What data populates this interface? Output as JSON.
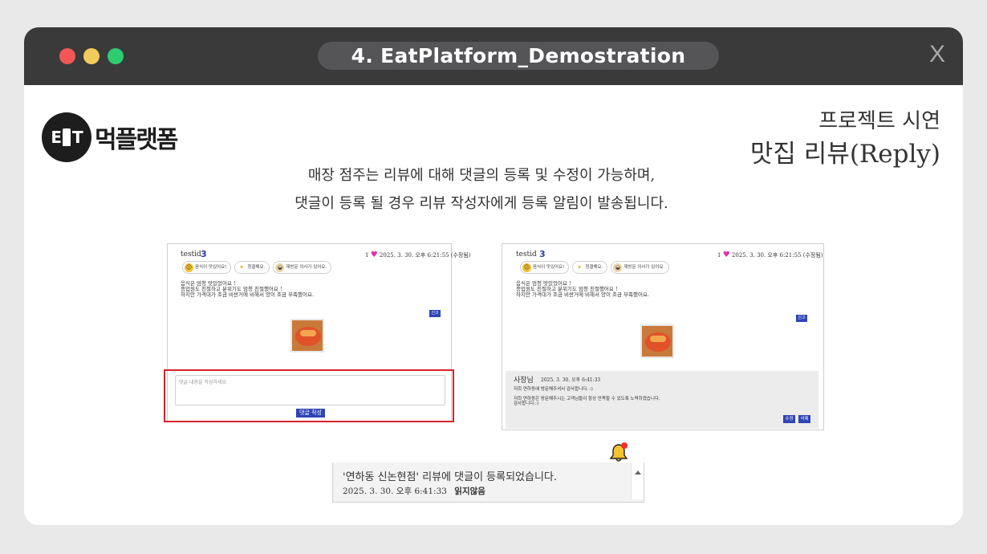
{
  "window": {
    "title": "4. EatPlatform_Demostration",
    "close_label": "X"
  },
  "logo": {
    "mark_left": "E",
    "mark_right": "T",
    "text": "먹플랫폼"
  },
  "heading": {
    "sub": "프로젝트 시연",
    "main": "맛집 리뷰(Reply)"
  },
  "description": {
    "line1": "매장 점주는 리뷰에 대해 댓글의 등록 및 수정이 가능하며,",
    "line2": "댓글이 등록 될 경우 리뷰 작성자에게 등록 알림이 발송됩니다."
  },
  "review": {
    "user": "testid",
    "score": "3",
    "likes": "1",
    "timestamp": "2025. 3. 30. 오후 6:21:55 (수정됨)",
    "tags": [
      "음식이 맛있어요!",
      "청결해요.",
      "재방문 의사가 있어요."
    ],
    "body": [
      "음식은 엄청 맛있었어요 !",
      "종업원도 친절하고 분위기도 엄청 친절했어요 !",
      "하지만 가격대가 조금 비싼거에 비해서 양이 조금 부족했어요."
    ],
    "report_label": "신고"
  },
  "reply_form": {
    "placeholder": "댓글 내용을 작성하세요",
    "submit_label": "댓글 작성"
  },
  "owner_reply": {
    "name": "사장님",
    "timestamp": "2025. 3. 30. 오후 6:41:33",
    "line1": "저희 연하동에 방문해주셔서 감사합니다. :)",
    "line2": "저희 연하동은 방문해주시는 고객님들이 항상 만족할 수 있도록 노력하겠습니다.",
    "line3": "감사합니다.:)",
    "edit_label": "수정",
    "delete_label": "삭제"
  },
  "notification": {
    "message": "'연하동 신논현점' 리뷰에 댓글이 등록되었습니다.",
    "timestamp": "2025. 3. 30. 오후 6:41:33",
    "status": "읽지않음"
  },
  "colors": {
    "titlebar": "#3a3a3a",
    "accent_button": "#2f45b5",
    "highlight_border": "#d6232a",
    "heart": "#e52ea0",
    "bell": "#f2c230",
    "bell_dot": "#ff2a2a"
  }
}
